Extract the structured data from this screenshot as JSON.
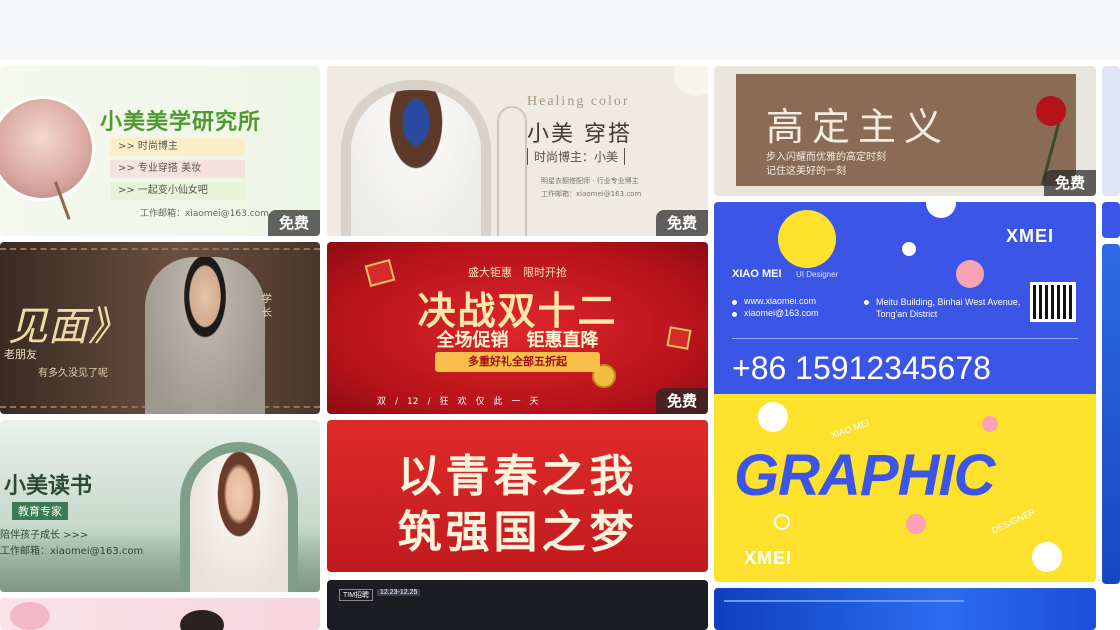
{
  "badge_free": "免费",
  "cards": {
    "c1": {
      "title": "小美美学研究所",
      "items": [
        ">> 时尚博主",
        ">> 专业穿搭 美妆",
        ">> 一起变小仙女吧"
      ],
      "email": "工作邮箱：xiaomei@163.com"
    },
    "c2": {
      "eng": "Healing color",
      "title": "小美 穿搭",
      "sub": "时尚博主：小美",
      "line1": "明星衣橱搭配师 · 行业专业博主",
      "line2": "工作邮箱：xiaomei@163.com"
    },
    "c3": {
      "title": "高定主义",
      "line1": "步入闪耀而优雅的高定时刻",
      "line2": "记住这美好的一刻"
    },
    "c4": {
      "title": "见面》",
      "side1": "学",
      "side2": "长",
      "line1": "老朋友",
      "line2": "有多久没见了呢"
    },
    "c5": {
      "top": "盛大钜惠　限时开抢",
      "title": "决战双十二",
      "sub": "全场促销　钜惠直降",
      "ribbon": "多重好礼全部五折起",
      "bottom": "双　/　12　/　狂　欢　仅　此　一　天"
    },
    "c6": {
      "brand": "XMEI",
      "name": "XIAO MEI",
      "role": "UI Designer",
      "web": "www.xiaomei.com",
      "mail": "xiaomei@163.com",
      "addr": "Meitu Building, Binhai West Avenue, Tong'an District",
      "phone": "+86 15912345678",
      "small": "XIAO MEI",
      "big": "GRAPHIC",
      "designer": "DESIGNER",
      "brand2": "XMEI"
    },
    "c7": {
      "title": "小美读书",
      "sub": "教育专家",
      "line1": "陪伴孩子成长 >>>",
      "email": "工作邮箱：xiaomei@163.com"
    },
    "c8": {
      "line1": "以青春之我",
      "line2": "筑强国之梦"
    },
    "c9": {
      "tag1": "TIM招聘",
      "tag2": "12.23-12.25"
    }
  },
  "colors": {
    "accent_blue": "#3b55e6",
    "accent_yellow": "#fde12d",
    "promo_red": "#c8161d"
  }
}
